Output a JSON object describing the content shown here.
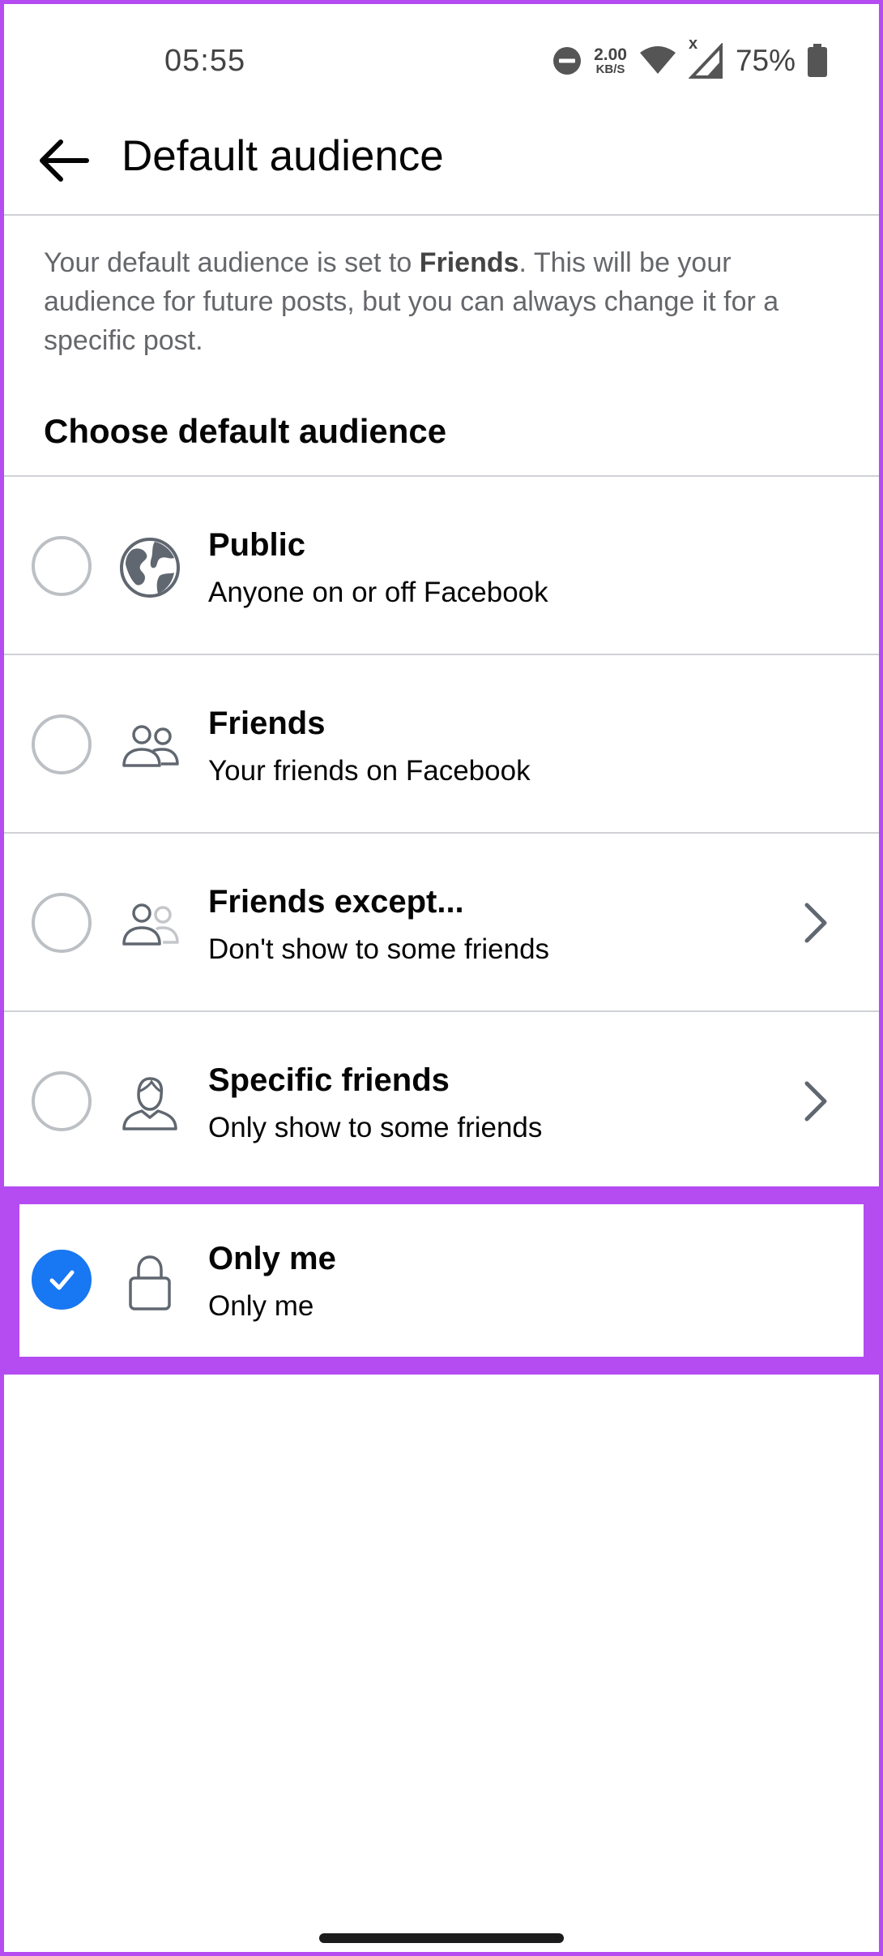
{
  "status_bar": {
    "time": "05:55",
    "net_speed_value": "2.00",
    "net_speed_unit": "KB/S",
    "signal_mark": "x",
    "battery_percent": "75%",
    "icons": [
      "dnd-icon",
      "wifi-icon",
      "signal-icon",
      "battery-icon"
    ]
  },
  "header": {
    "title": "Default audience",
    "back_icon": "back-arrow-icon"
  },
  "description": {
    "prefix": "Your default audience is set to ",
    "current_audience": "Friends",
    "suffix": ". This will be your audience for future posts, but you can always change it for a specific post."
  },
  "section_title": "Choose default audience",
  "options": [
    {
      "title": "Public",
      "subtitle": "Anyone on or off Facebook",
      "icon": "globe-icon",
      "selected": false,
      "has_chevron": false
    },
    {
      "title": "Friends",
      "subtitle": "Your friends on Facebook",
      "icon": "friends-icon",
      "selected": false,
      "has_chevron": false
    },
    {
      "title": "Friends except...",
      "subtitle": "Don't show to some friends",
      "icon": "friends-except-icon",
      "selected": false,
      "has_chevron": true
    },
    {
      "title": "Specific friends",
      "subtitle": "Only show to some friends",
      "icon": "specific-friend-icon",
      "selected": false,
      "has_chevron": true
    },
    {
      "title": "Only me",
      "subtitle": "Only me",
      "icon": "lock-icon",
      "selected": true,
      "has_chevron": false
    }
  ],
  "colors": {
    "accent": "#1877f2",
    "highlight": "#b44cf2",
    "text_primary": "#050505",
    "text_secondary": "#65676b",
    "divider": "#cfd1d5"
  }
}
